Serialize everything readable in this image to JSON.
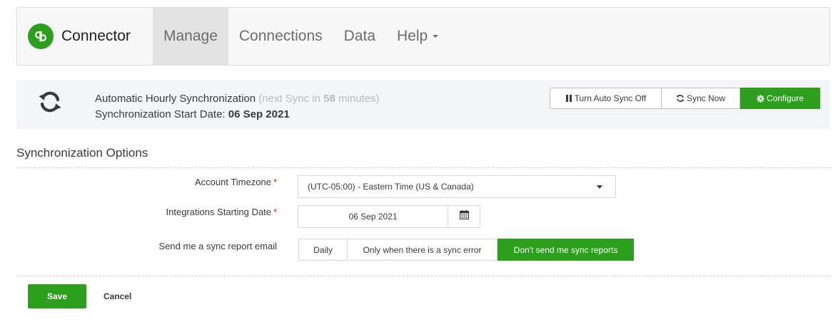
{
  "app": {
    "brand_name": "Connector",
    "logo_text": "qb"
  },
  "nav": {
    "items": [
      {
        "label": "Manage",
        "active": true
      },
      {
        "label": "Connections",
        "active": false
      },
      {
        "label": "Data",
        "active": false
      },
      {
        "label": "Help",
        "active": false,
        "has_caret": true
      }
    ]
  },
  "sync": {
    "title": "Automatic Hourly Synchronization",
    "next_prefix": "(next Sync in",
    "next_minutes": "58",
    "next_suffix": "minutes)",
    "start_label": "Synchronization Start Date:",
    "start_date": "06 Sep 2021",
    "buttons": {
      "auto_sync_off": "Turn Auto Sync Off",
      "sync_now": "Sync Now",
      "configure": "Configure"
    }
  },
  "options": {
    "section_title": "Synchronization Options",
    "timezone_label": "Account Timezone",
    "timezone_value": "(UTC-05:00) -  Eastern Time (US & Canada)",
    "start_date_label": "Integrations Starting Date",
    "start_date_value": "06 Sep 2021",
    "report_label": "Send me a sync report email",
    "report_choices": [
      {
        "label": "Daily",
        "selected": false
      },
      {
        "label": "Only when there is a sync error",
        "selected": false
      },
      {
        "label": "Don't send me sync reports",
        "selected": true
      }
    ],
    "required_marker": "*"
  },
  "actions": {
    "save": "Save",
    "cancel": "Cancel"
  },
  "colors": {
    "brand_green": "#2ca01c",
    "required_red": "#d52b1e",
    "active_nav_bg": "#e3e3e3"
  }
}
